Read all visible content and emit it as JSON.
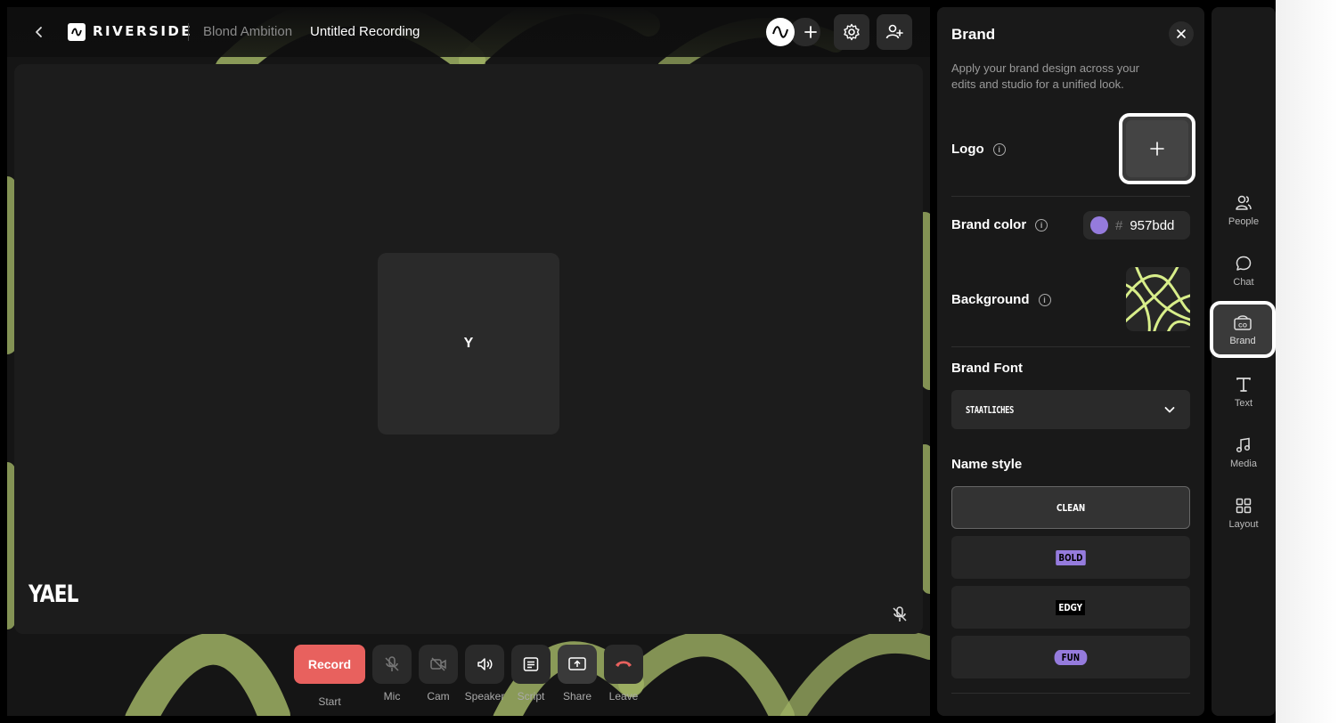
{
  "header": {
    "back_icon": "chevron-left-icon",
    "brand_name": "RIVERSIDE",
    "show_name": "Blond Ambition",
    "recording_title": "Untitled Recording"
  },
  "stage": {
    "tile_initial": "Y",
    "participant_name": "YAEL"
  },
  "controls": {
    "record_label": "Record",
    "record_caption": "Start",
    "items": [
      {
        "label": "Mic",
        "icon": "mic-off-icon"
      },
      {
        "label": "Cam",
        "icon": "camera-off-icon"
      },
      {
        "label": "Speaker",
        "icon": "speaker-icon"
      },
      {
        "label": "Script",
        "icon": "script-icon"
      },
      {
        "label": "Share",
        "icon": "share-screen-icon"
      },
      {
        "label": "Leave",
        "icon": "hang-up-icon"
      }
    ]
  },
  "brand_panel": {
    "title": "Brand",
    "description": "Apply your brand design across your edits and studio for a unified look.",
    "logo_label": "Logo",
    "brand_color_label": "Brand color",
    "brand_color_value": "957bdd",
    "brand_color_hex": "#957bdd",
    "background_label": "Background",
    "brand_font_label": "Brand Font",
    "brand_font_value": "STAATLICHES",
    "name_style_label": "Name style",
    "name_styles": [
      "CLEAN",
      "BOLD",
      "EDGY",
      "FUN"
    ],
    "selected_name_style": "CLEAN"
  },
  "rail": {
    "items": [
      {
        "label": "People",
        "icon": "people-icon"
      },
      {
        "label": "Chat",
        "icon": "chat-icon"
      },
      {
        "label": "Brand",
        "icon": "brand-icon"
      },
      {
        "label": "Text",
        "icon": "text-icon"
      },
      {
        "label": "Media",
        "icon": "music-note-icon"
      },
      {
        "label": "Layout",
        "icon": "layout-grid-icon"
      }
    ],
    "active": "Brand"
  },
  "colors": {
    "accent": "#957bdd",
    "record": "#e8615e",
    "background_stroke": "#b8cf74"
  }
}
